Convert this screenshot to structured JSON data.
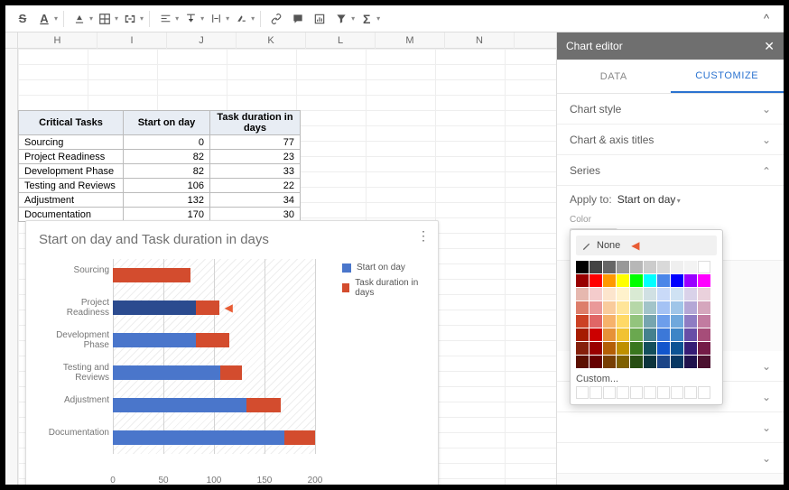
{
  "toolbar": {
    "expand_icon": "^"
  },
  "editor": {
    "title": "Chart editor",
    "tabs": [
      "DATA",
      "CUSTOMIZE"
    ],
    "active_tab": 1,
    "accordions": [
      {
        "label": "Chart style",
        "expanded": false
      },
      {
        "label": "Chart & axis titles",
        "expanded": false
      },
      {
        "label": "Series",
        "expanded": true
      },
      {
        "label": "",
        "expanded": false
      },
      {
        "label": "",
        "expanded": false
      },
      {
        "label": "",
        "expanded": false
      },
      {
        "label": "",
        "expanded": false
      }
    ],
    "series": {
      "apply_to_label": "Apply to:",
      "apply_to_value": "Start on day",
      "color_label": "Color",
      "none_label": "None",
      "custom_label": "Custom..."
    }
  },
  "columns": [
    "H",
    "I",
    "J",
    "K",
    "L",
    "M",
    "N"
  ],
  "table": {
    "headers": [
      "Critical Tasks",
      "Start on day",
      "Task duration in days"
    ],
    "rows": [
      {
        "task": "Sourcing",
        "start": 0,
        "dur": 77
      },
      {
        "task": "Project Readiness",
        "start": 82,
        "dur": 23
      },
      {
        "task": "Development Phase",
        "start": 82,
        "dur": 33
      },
      {
        "task": "Testing and Reviews",
        "start": 106,
        "dur": 22
      },
      {
        "task": "Adjustment",
        "start": 132,
        "dur": 34
      },
      {
        "task": "Documentation",
        "start": 170,
        "dur": 30
      }
    ]
  },
  "chart_data": {
    "type": "bar",
    "orientation": "horizontal",
    "stacked": true,
    "title": "Start on day and Task duration in days",
    "categories": [
      "Sourcing",
      "Project Readiness",
      "Development Phase",
      "Testing and Reviews",
      "Adjustment",
      "Documentation"
    ],
    "series": [
      {
        "name": "Start on day",
        "values": [
          0,
          82,
          82,
          106,
          132,
          170
        ],
        "color": "#4a76cb"
      },
      {
        "name": "Task duration in days",
        "values": [
          77,
          23,
          33,
          22,
          34,
          30
        ],
        "color": "#d34c2e"
      }
    ],
    "xlim": [
      0,
      200
    ],
    "xticks": [
      0,
      50,
      100,
      150,
      200
    ],
    "selected_category": 1
  },
  "color_palette": {
    "greys": [
      "#000000",
      "#434343",
      "#666666",
      "#999999",
      "#b7b7b7",
      "#cccccc",
      "#d9d9d9",
      "#efefef",
      "#f3f3f3",
      "#ffffff"
    ],
    "brights": [
      "#980000",
      "#ff0000",
      "#ff9900",
      "#ffff00",
      "#00ff00",
      "#00ffff",
      "#4a86e8",
      "#0000ff",
      "#9900ff",
      "#ff00ff"
    ],
    "grid": [
      [
        "#e6b8af",
        "#f4cccc",
        "#fce5cd",
        "#fff2cc",
        "#d9ead3",
        "#d0e0e3",
        "#c9daf8",
        "#cfe2f3",
        "#d9d2e9",
        "#ead1dc"
      ],
      [
        "#dd7e6b",
        "#ea9999",
        "#f9cb9c",
        "#ffe599",
        "#b6d7a8",
        "#a2c4c9",
        "#a4c2f4",
        "#9fc5e8",
        "#b4a7d6",
        "#d5a6bd"
      ],
      [
        "#cc4125",
        "#e06666",
        "#f6b26b",
        "#ffd966",
        "#93c47d",
        "#76a5af",
        "#6d9eeb",
        "#6fa8dc",
        "#8e7cc3",
        "#c27ba0"
      ],
      [
        "#a61c00",
        "#cc0000",
        "#e69138",
        "#f1c232",
        "#6aa84f",
        "#45818e",
        "#3c78d8",
        "#3d85c6",
        "#674ea7",
        "#a64d79"
      ],
      [
        "#85200c",
        "#990000",
        "#b45f06",
        "#bf9000",
        "#38761d",
        "#134f5c",
        "#1155cc",
        "#0b5394",
        "#351c75",
        "#741b47"
      ],
      [
        "#5b0f00",
        "#660000",
        "#783f04",
        "#7f6000",
        "#274e13",
        "#0c343d",
        "#1c4587",
        "#073763",
        "#20124d",
        "#4c1130"
      ]
    ]
  }
}
